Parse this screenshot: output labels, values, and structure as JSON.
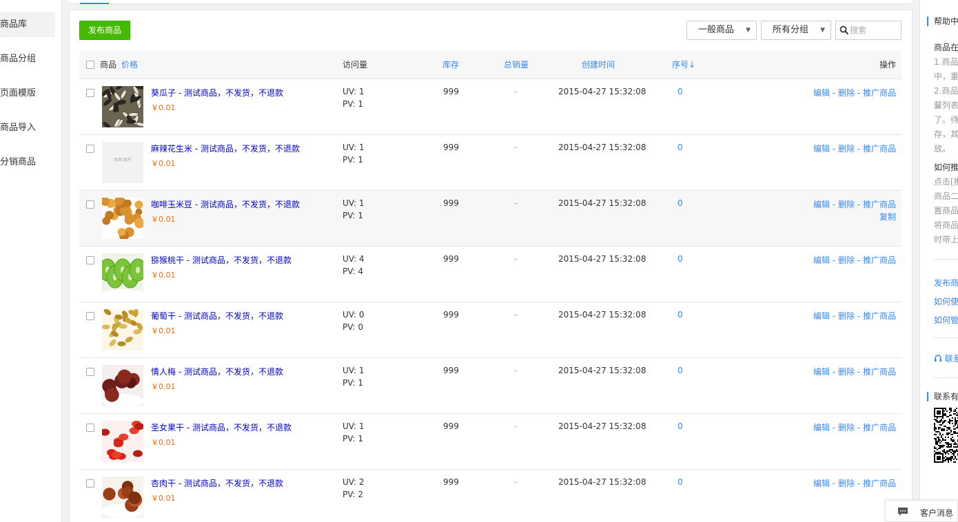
{
  "nav": {
    "items": [
      {
        "label": "商品库",
        "active": true
      },
      {
        "label": "商品分组"
      },
      {
        "label": "页面模版"
      },
      {
        "label": "商品导入"
      },
      {
        "label": "分销商品"
      }
    ]
  },
  "toolbar": {
    "publish_label": "发布商品",
    "type_select": "一般商品",
    "group_select": "所有分组",
    "search_placeholder": "搜索"
  },
  "table": {
    "headers": {
      "product": "商品",
      "price": "价格",
      "visits": "访问量",
      "stock": "库存",
      "sales": "总销量",
      "created": "创建时间",
      "seq": "序号↓",
      "ops": "操作"
    },
    "rows": [
      {
        "name": "葵瓜子 - 测试商品，不发货，不退款",
        "price": "￥0.01",
        "uv": "UV: 1",
        "pv": "PV: 1",
        "stock": "999",
        "sales": "-",
        "created": "2015-04-27 15:32:08",
        "seq": "0",
        "thumb": "sunflower-seeds"
      },
      {
        "name": "麻辣花生米 - 测试商品，不发货，不退款",
        "price": "￥0.01",
        "uv": "UV: 1",
        "pv": "PV: 1",
        "stock": "999",
        "sales": "-",
        "created": "2015-04-27 15:32:08",
        "seq": "0",
        "thumb": "placeholder",
        "thumb_text": "本图 图片"
      },
      {
        "name": "咖啡玉米豆 - 测试商品，不发货，不退款",
        "price": "￥0.01",
        "uv": "UV: 1",
        "pv": "PV: 1",
        "stock": "999",
        "sales": "-",
        "created": "2015-04-27 15:32:08",
        "seq": "0",
        "thumb": "corn-beans",
        "hover": true
      },
      {
        "name": "猕猴桃干 - 测试商品，不发货，不退款",
        "price": "￥0.01",
        "uv": "UV: 4",
        "pv": "PV: 4",
        "stock": "999",
        "sales": "-",
        "created": "2015-04-27 15:32:08",
        "seq": "0",
        "thumb": "dried-kiwi"
      },
      {
        "name": "葡萄干 - 测试商品，不发货，不退款",
        "price": "￥0.01",
        "uv": "UV: 0",
        "pv": "PV: 0",
        "stock": "999",
        "sales": "-",
        "created": "2015-04-27 15:32:08",
        "seq": "0",
        "thumb": "raisins"
      },
      {
        "name": "情人梅 - 测试商品，不发货，不退款",
        "price": "￥0.01",
        "uv": "UV: 1",
        "pv": "PV: 1",
        "stock": "999",
        "sales": "-",
        "created": "2015-04-27 15:32:08",
        "seq": "0",
        "thumb": "plums"
      },
      {
        "name": "圣女果干 - 测试商品，不发货，不退款",
        "price": "￥0.01",
        "uv": "UV: 1",
        "pv": "PV: 1",
        "stock": "999",
        "sales": "-",
        "created": "2015-04-27 15:32:08",
        "seq": "0",
        "thumb": "dried-tomatoes"
      },
      {
        "name": "杏肉干 - 测试商品，不发货，不退款",
        "price": "￥0.01",
        "uv": "UV: 2",
        "pv": "PV: 2",
        "stock": "999",
        "sales": "-",
        "created": "2015-04-27 15:32:08",
        "seq": "0",
        "thumb": "dried-apricot"
      }
    ],
    "ops": {
      "edit": "编辑",
      "delete": "删除",
      "promote": "推广商品",
      "copy": "复制",
      "sep": " - "
    }
  },
  "help": {
    "title": "帮助中",
    "section1_title": "商品在",
    "section1_lines": [
      "1.商品",
      "中，重",
      "2.商品",
      "馨列表",
      "了。待",
      "存，其",
      "放。"
    ],
    "section2_title": "如何推",
    "section2_lines": [
      "点击[推",
      "商品二",
      "置商品",
      "将商品",
      "时带上"
    ],
    "links": [
      "发布商",
      "如何使",
      "如何管"
    ],
    "contact_link": "联系",
    "contact_title": "联系有"
  },
  "message_bar": {
    "label": "客户消息"
  },
  "colors": {
    "accent": "#3388ff",
    "publish": "#44bb00",
    "price": "#ff6600",
    "product_link": "#0000cc"
  }
}
